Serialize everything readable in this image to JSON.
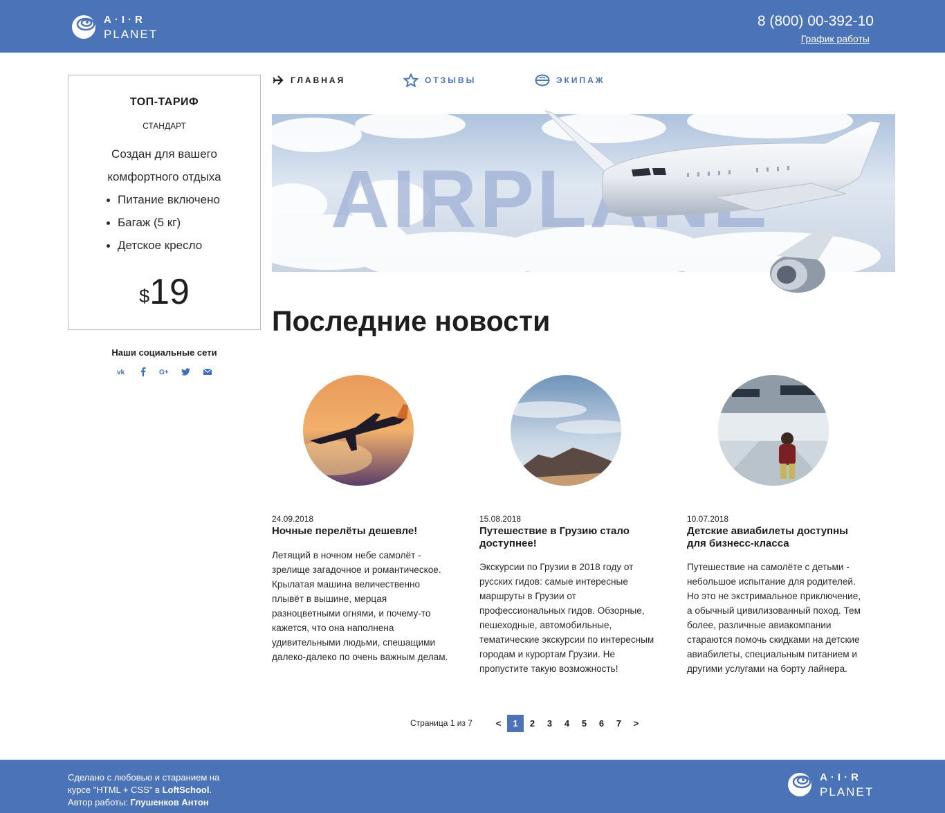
{
  "header": {
    "logo_air": "A·I·R",
    "logo_planet": "PLANET",
    "phone": "8 (800) 00-392-10",
    "schedule_link": "График работы"
  },
  "nav": [
    {
      "label": "ГЛАВНАЯ",
      "icon": "plane-arrow-icon",
      "active": true
    },
    {
      "label": "ОТЗЫВЫ",
      "icon": "star-icon",
      "active": false
    },
    {
      "label": "ЭКИПАЖ",
      "icon": "pilot-cap-icon",
      "active": false
    }
  ],
  "banner": {
    "word": "AIRPLANE"
  },
  "tariff": {
    "title": "ТОП-ТАРИФ",
    "subtitle": "СТАНДАРТ",
    "description": "Создан для вашего комфортного отдыха",
    "features": [
      "Питание включено",
      "Багаж (5 кг)",
      "Детское кресло"
    ],
    "currency": "$",
    "price": "19"
  },
  "social": {
    "title": "Наши социальные сети",
    "icons": [
      "vk-icon",
      "facebook-icon",
      "google-plus-icon",
      "twitter-icon",
      "mail-icon"
    ]
  },
  "news_title": "Последние новости",
  "news": [
    {
      "date": "24.09.2018",
      "title": "Ночные перелёты дешевле!",
      "text": "Летящий в ночном небе самолёт - зрелище загадочное и романтическое. Крылатая машина величественно плывёт в вышине, мерцая разноцветными огнями, и почему-то кажется, что она наполнена удивительными людьми, спешащими далеко-далеко по очень важным делам."
    },
    {
      "date": "15.08.2018",
      "title": "Путешествие в Грузию стало доступнее!",
      "text": "Экскурсии по Грузии в 2018 году от русских гидов: самые интересные маршруты в Грузии от профессиональных гидов. Обзорные, пешеходные, автомобильные, тематические экскурсии по интересным городам и курортам Грузии. Не пропустите такую возможность!"
    },
    {
      "date": "10.07.2018",
      "title": "Детские авиабилеты доступны для бизнесс-класса",
      "text": "Путешествие на самолёте с детьми - небольшое испытание для родителей. Но это не экстримальное приключение, а обычный цивилизованный поход. Тем более, различные авиакомпании стараются помочь скидками на детские авиабилеты, специальным питанием и другими услугами на борту лайнера."
    }
  ],
  "pagination": {
    "info": "Страница 1 из 7",
    "prev": "<",
    "pages": [
      "1",
      "2",
      "3",
      "4",
      "5",
      "6",
      "7"
    ],
    "current": "1",
    "next": ">"
  },
  "footer": {
    "line1": "Сделано с любовью и старанием на",
    "line2_prefix": "курсе \"HTML + CSS\" в ",
    "line2_school": "LoftSchool",
    "line2_suffix": ".",
    "line3_prefix": "Автор работы: ",
    "line3_author": "Глушенков Антон"
  },
  "colors": {
    "brand": "#4b73b7",
    "accent": "#4a74b7"
  }
}
